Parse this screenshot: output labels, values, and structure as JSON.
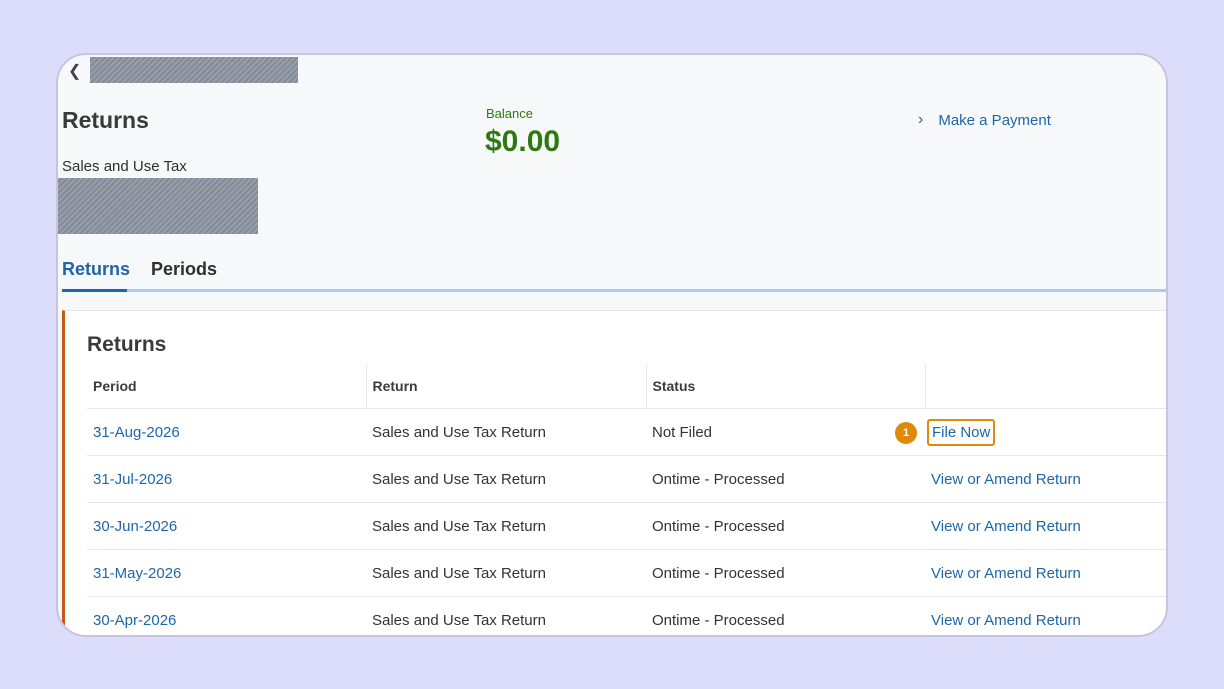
{
  "header": {
    "back_icon": "chevron-left-icon",
    "page_title": "Returns",
    "subtitle": "Sales and Use Tax"
  },
  "balance": {
    "label": "Balance",
    "value": "$0.00",
    "color": "#2e7a12"
  },
  "payment": {
    "label": "Make a Payment",
    "icon": "chevron-right-icon"
  },
  "tabs": [
    {
      "label": "Returns",
      "active": true
    },
    {
      "label": "Periods",
      "active": false
    }
  ],
  "panel": {
    "title": "Returns",
    "accent": "#c75a12"
  },
  "table": {
    "columns": [
      "Period",
      "Return",
      "Status",
      ""
    ],
    "rows": [
      {
        "period": "31-Aug-2026",
        "return": "Sales and Use Tax Return",
        "status": "Not Filed",
        "action": "File Now"
      },
      {
        "period": "31-Jul-2026",
        "return": "Sales and Use Tax Return",
        "status": "Ontime - Processed",
        "action": "View or Amend Return"
      },
      {
        "period": "30-Jun-2026",
        "return": "Sales and Use Tax Return",
        "status": "Ontime - Processed",
        "action": "View or Amend Return"
      },
      {
        "period": "31-May-2026",
        "return": "Sales and Use Tax Return",
        "status": "Ontime - Processed",
        "action": "View or Amend Return"
      },
      {
        "period": "30-Apr-2026",
        "return": "Sales and Use Tax Return",
        "status": "Ontime - Processed",
        "action": "View or Amend Return"
      }
    ]
  },
  "annotation": {
    "step_number": "1",
    "color": "#e08a0c"
  },
  "link_color": "#1e66a8"
}
